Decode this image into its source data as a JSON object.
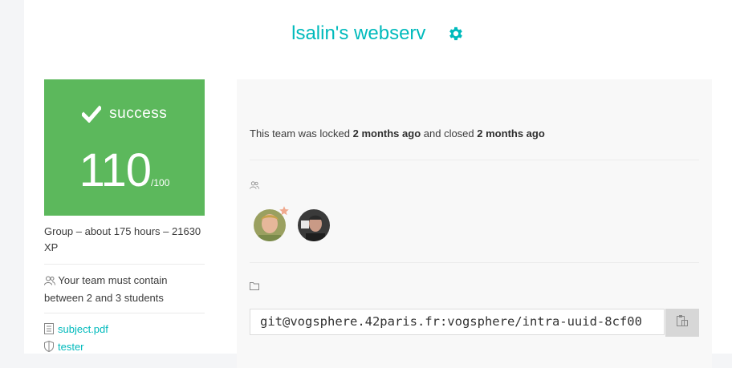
{
  "header": {
    "title": "lsalin's webserv",
    "settings_icon": "gear-icon"
  },
  "score_card": {
    "status": "success",
    "score": "110",
    "max": "/100",
    "color": "#5cb85c"
  },
  "project_info": {
    "group_line": "Group – about 175 hours – 21630 XP",
    "team_size": "Your team must contain between 2 and 3 students"
  },
  "files": [
    {
      "label": "subject.pdf",
      "icon": "document-icon"
    },
    {
      "label": "tester",
      "icon": "shield-icon"
    }
  ],
  "team_panel": {
    "lock_prefix": "This team was locked",
    "locked_ago": "2 months ago",
    "lock_middle": "and closed",
    "closed_ago": "2 months ago",
    "members_icon": "users-icon",
    "leader_icon": "star-icon",
    "repo_icon": "folder-icon",
    "repo_url": "git@vogsphere.42paris.fr:vogsphere/intra-uuid-8cf00",
    "copy_icon": "clipboard-icon"
  },
  "accent_color": "#00babc"
}
